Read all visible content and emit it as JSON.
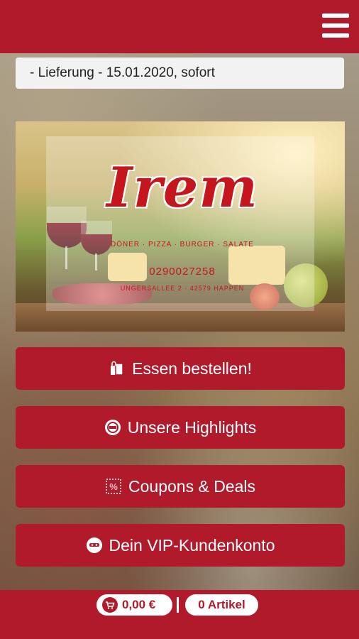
{
  "header": {
    "menu_icon": "hamburger-menu-icon"
  },
  "delivery": {
    "text": "- Lieferung - 15.01.2020, sofort"
  },
  "hero": {
    "brand": "Irem",
    "tagline": "DÖNER · PIZZA · BURGER · SALATE",
    "phone": "0290027258",
    "address": "UNGERSALLEE 2 · 42579 HAPPEN"
  },
  "buttons": [
    {
      "label": "Essen bestellen!",
      "icon": "shopping-bags-icon"
    },
    {
      "label": "Unsere Highlights",
      "icon": "seal-badge-icon"
    },
    {
      "label": "Coupons & Deals",
      "icon": "coupon-scissors-icon"
    },
    {
      "label": "Dein VIP-Kundenkonto",
      "icon": "vip-mask-icon"
    }
  ],
  "footer": {
    "price": "0,00 €",
    "items": "0 Artikel",
    "cart_icon": "cart-icon"
  },
  "colors": {
    "brand": "#b11a2b",
    "logo": "#c4161c",
    "delivery_bg": "#f2f2f2"
  }
}
